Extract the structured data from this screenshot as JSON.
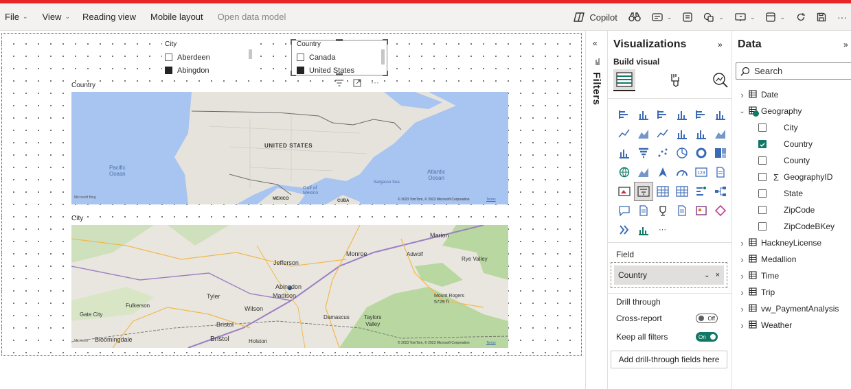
{
  "ribbon": {
    "menus": [
      {
        "label": "File",
        "has_chevron": true
      },
      {
        "label": "View",
        "has_chevron": true
      },
      {
        "label": "Reading view",
        "has_chevron": false
      },
      {
        "label": "Mobile layout",
        "has_chevron": false
      },
      {
        "label": "Open data model",
        "has_chevron": false,
        "disabled": true
      }
    ],
    "copilot_label": "Copilot",
    "accent_color": "#e8262a"
  },
  "canvas": {
    "city_slicer": {
      "title": "City",
      "options": [
        {
          "label": "Aberdeen",
          "checked": false
        },
        {
          "label": "Abingdon",
          "checked": true
        }
      ]
    },
    "country_slicer": {
      "title": "Country",
      "options": [
        {
          "label": "Canada",
          "checked": false
        },
        {
          "label": "United States",
          "checked": true
        }
      ]
    },
    "map1": {
      "title": "Country",
      "labels": {
        "country": "UNITED STATES",
        "pacific": "Pacific\nOcean",
        "atlantic": "Atlantic\nOcean",
        "gulf": "Gulf of\nMexico",
        "sargasso": "Sargasso Sea",
        "mexico": "MEXICO",
        "cuba": "CUBA"
      },
      "attribution": "© 2023 TomTom, © 2023 Microsoft Corporation",
      "terms": "Terms",
      "bing": "Microsoft Bing"
    },
    "map2": {
      "title": "City",
      "labels": {
        "marion": "Marion",
        "monroe": "Monroe",
        "adwolf": "Adwolf",
        "rye_valley": "Rye Valley",
        "jefferson": "Jefferson",
        "abingdon": "Abingdon",
        "madison": "Madison",
        "tyler": "Tyler",
        "fulkerson": "Fulkerson",
        "wilson": "Wilson",
        "gate_city": "Gate City",
        "bristol1": "Bristol",
        "bristol2": "Bristol",
        "damascus": "Damascus",
        "taylors_valley": "Taylors\nValley",
        "mount_rogers": "Mount Rogers\n5729 ft",
        "bloomingdale": "Bloomingdale",
        "holston": "Holston"
      },
      "attribution": "© 2023 TomTom, © 2023 Microsoft Corporation",
      "terms": "Terms",
      "bing": "Microsoft"
    }
  },
  "filters": {
    "label": "Filters"
  },
  "visualizations": {
    "title": "Visualizations",
    "build_visual": "Build visual",
    "field_label": "Field",
    "field_value": "Country",
    "drill_through": "Drill through",
    "cross_report": {
      "label": "Cross-report",
      "state": "Off"
    },
    "keep_all_filters": {
      "label": "Keep all filters",
      "state": "On"
    },
    "add_drill_label": "Add drill-through fields here",
    "more_label": "···"
  },
  "data": {
    "title": "Data",
    "search_placeholder": "Search",
    "tables": [
      {
        "name": "Date",
        "expanded": false
      },
      {
        "name": "Geography",
        "expanded": true
      },
      {
        "name": "HackneyLicense",
        "expanded": false
      },
      {
        "name": "Medallion",
        "expanded": false
      },
      {
        "name": "Time",
        "expanded": false
      },
      {
        "name": "Trip",
        "expanded": false
      },
      {
        "name": "vw_PaymentAnalysis",
        "expanded": false
      },
      {
        "name": "Weather",
        "expanded": false
      }
    ],
    "geography_fields": [
      {
        "name": "City",
        "checked": false,
        "sum": false
      },
      {
        "name": "Country",
        "checked": true,
        "sum": false
      },
      {
        "name": "County",
        "checked": false,
        "sum": false
      },
      {
        "name": "GeographyID",
        "checked": false,
        "sum": true
      },
      {
        "name": "State",
        "checked": false,
        "sum": false
      },
      {
        "name": "ZipCode",
        "checked": false,
        "sum": false
      },
      {
        "name": "ZipCodeBKey",
        "checked": false,
        "sum": false
      }
    ]
  },
  "colors": {
    "accent_green": "#117865",
    "ocean": "#a8c4f0",
    "land": "#e8e4dc",
    "forest": "#b9d7a0"
  }
}
